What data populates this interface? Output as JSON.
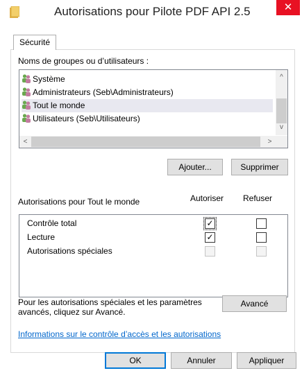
{
  "window": {
    "title": "Autorisations pour Pilote PDF API 2.5",
    "close_glyph": "✕"
  },
  "tabs": [
    {
      "label": "Sécurité",
      "active": true
    }
  ],
  "groups": {
    "label": "Noms de groupes ou d’utilisateurs :",
    "items": [
      {
        "label": "Système",
        "selected": false,
        "icon": "users-icon"
      },
      {
        "label": "Administrateurs (Seb\\Administrateurs)",
        "selected": false,
        "icon": "users-icon"
      },
      {
        "label": "Tout le monde",
        "selected": true,
        "icon": "users-icon"
      },
      {
        "label": "Utilisateurs (Seb\\Utilisateurs)",
        "selected": false,
        "icon": "users-icon"
      }
    ],
    "scroll_up": "^",
    "scroll_down": "v",
    "scroll_left": "<",
    "scroll_right": ">"
  },
  "buttons": {
    "add": "Ajouter...",
    "remove": "Supprimer",
    "advanced": "Avancé",
    "ok": "OK",
    "cancel": "Annuler",
    "apply": "Appliquer"
  },
  "permissions": {
    "label": "Autorisations pour Tout le monde",
    "allow_header": "Autoriser",
    "deny_header": "Refuser",
    "rows": [
      {
        "label": "Contrôle total",
        "allow": true,
        "deny": false,
        "disabled": false
      },
      {
        "label": "Lecture",
        "allow": true,
        "deny": false,
        "disabled": false
      },
      {
        "label": "Autorisations spéciales",
        "allow": false,
        "deny": false,
        "disabled": true
      }
    ]
  },
  "advanced_text_line1": "Pour les autorisations spéciales et les paramètres",
  "advanced_text_line2": "avancés, cliquez sur Avancé.",
  "help_link": "Informations sur le contrôle d’accès et les autorisations",
  "colors": {
    "close": "#e81123",
    "link": "#0066cc",
    "selection": "#e8e8f0"
  }
}
